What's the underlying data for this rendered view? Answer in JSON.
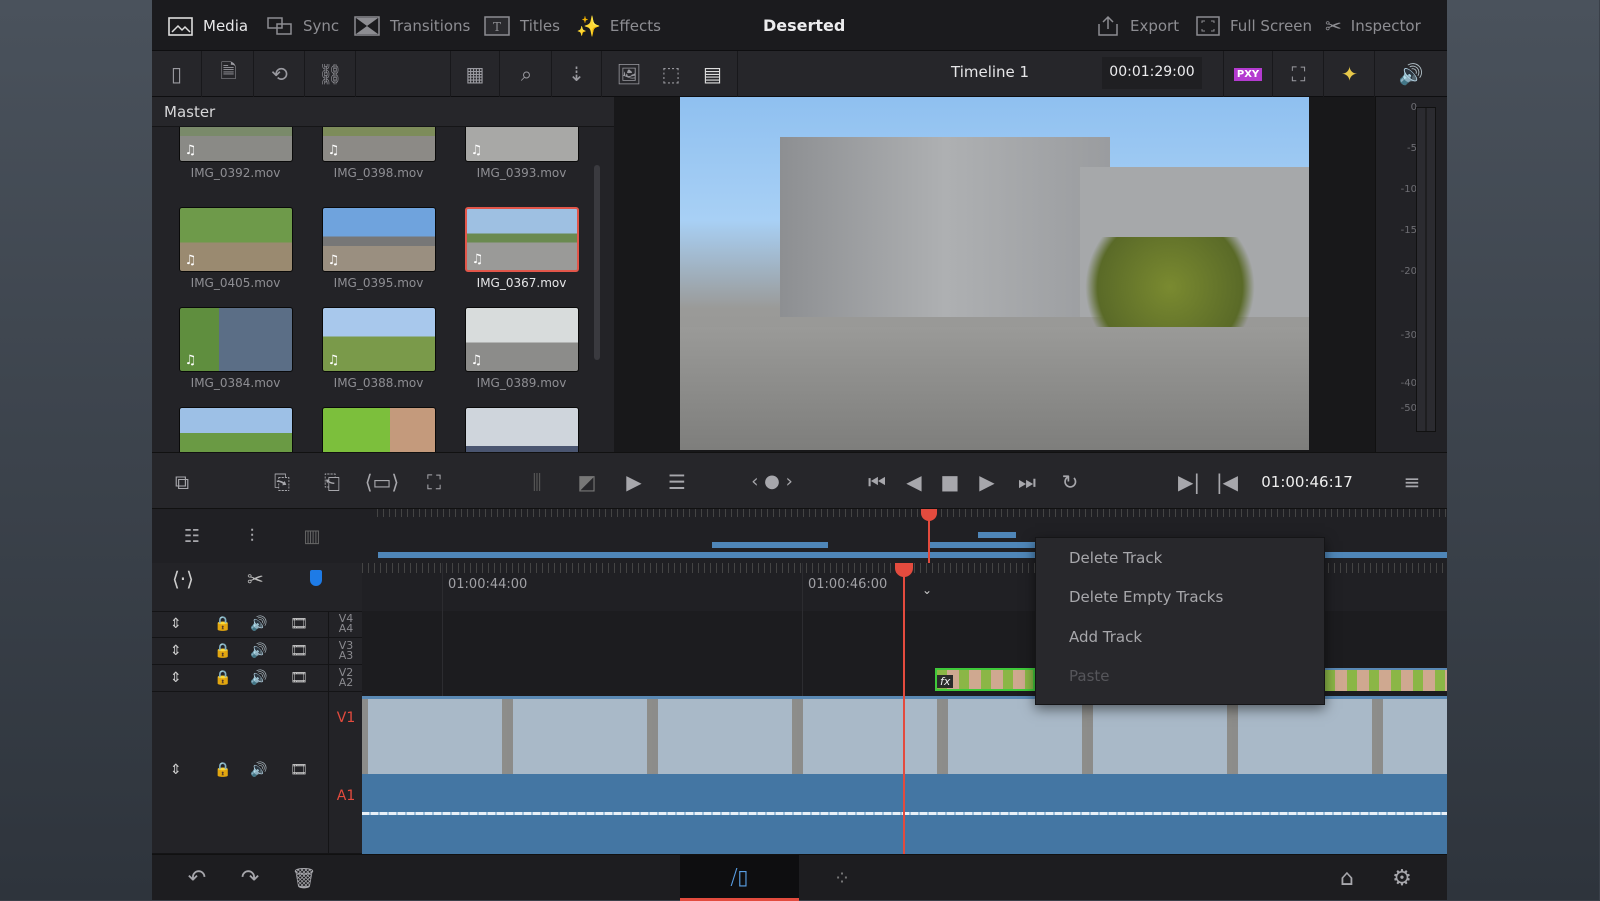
{
  "topbar": {
    "tabs": [
      {
        "label": "Media",
        "icon": "media-icon",
        "active": true
      },
      {
        "label": "Sync",
        "icon": "sync-icon"
      },
      {
        "label": "Transitions",
        "icon": "transitions-icon"
      },
      {
        "label": "Titles",
        "icon": "titles-icon"
      },
      {
        "label": "Effects",
        "icon": "effects-icon"
      }
    ],
    "project_title": "Deserted",
    "actions": [
      {
        "label": "Export",
        "icon": "export-icon"
      },
      {
        "label": "Full Screen",
        "icon": "full-screen-icon"
      },
      {
        "label": "Inspector",
        "icon": "inspector-icon"
      }
    ]
  },
  "toolbar": {
    "timeline_name": "Timeline 1",
    "timeline_duration": "00:01:29:00",
    "proxy_badge": "PXY"
  },
  "media_pool": {
    "bin": "Master",
    "clips": [
      {
        "name": "IMG_0392.mov"
      },
      {
        "name": "IMG_0398.mov"
      },
      {
        "name": "IMG_0393.mov"
      },
      {
        "name": "IMG_0405.mov"
      },
      {
        "name": "IMG_0395.mov"
      },
      {
        "name": "IMG_0367.mov",
        "selected": true
      },
      {
        "name": "IMG_0384.mov"
      },
      {
        "name": "IMG_0388.mov"
      },
      {
        "name": "IMG_0389.mov"
      },
      {
        "name": ""
      },
      {
        "name": ""
      },
      {
        "name": ""
      }
    ]
  },
  "meter": {
    "ticks": [
      "0",
      "-5",
      "-10",
      "-15",
      "-20",
      "-30",
      "-40",
      "-50"
    ]
  },
  "transport": {
    "timecode": "01:00:46:17"
  },
  "timeline": {
    "ruler_labels": [
      "01:00:44:00",
      "01:00:46:00"
    ],
    "tracks": [
      {
        "label": "V4",
        "sub": "A4"
      },
      {
        "label": "V3",
        "sub": "A3"
      },
      {
        "label": "V2",
        "sub": "A2"
      },
      {
        "label": "V1"
      },
      {
        "label": "A1"
      }
    ],
    "fx_label": "fx",
    "accent": "#e34b3e",
    "audio_color": "#4476a3"
  },
  "context_menu": {
    "items": [
      {
        "label": "Delete Track",
        "enabled": true
      },
      {
        "label": "Delete Empty Tracks",
        "enabled": true
      },
      {
        "label": "Add Track",
        "enabled": true
      },
      {
        "label": "Paste",
        "enabled": false
      }
    ]
  }
}
